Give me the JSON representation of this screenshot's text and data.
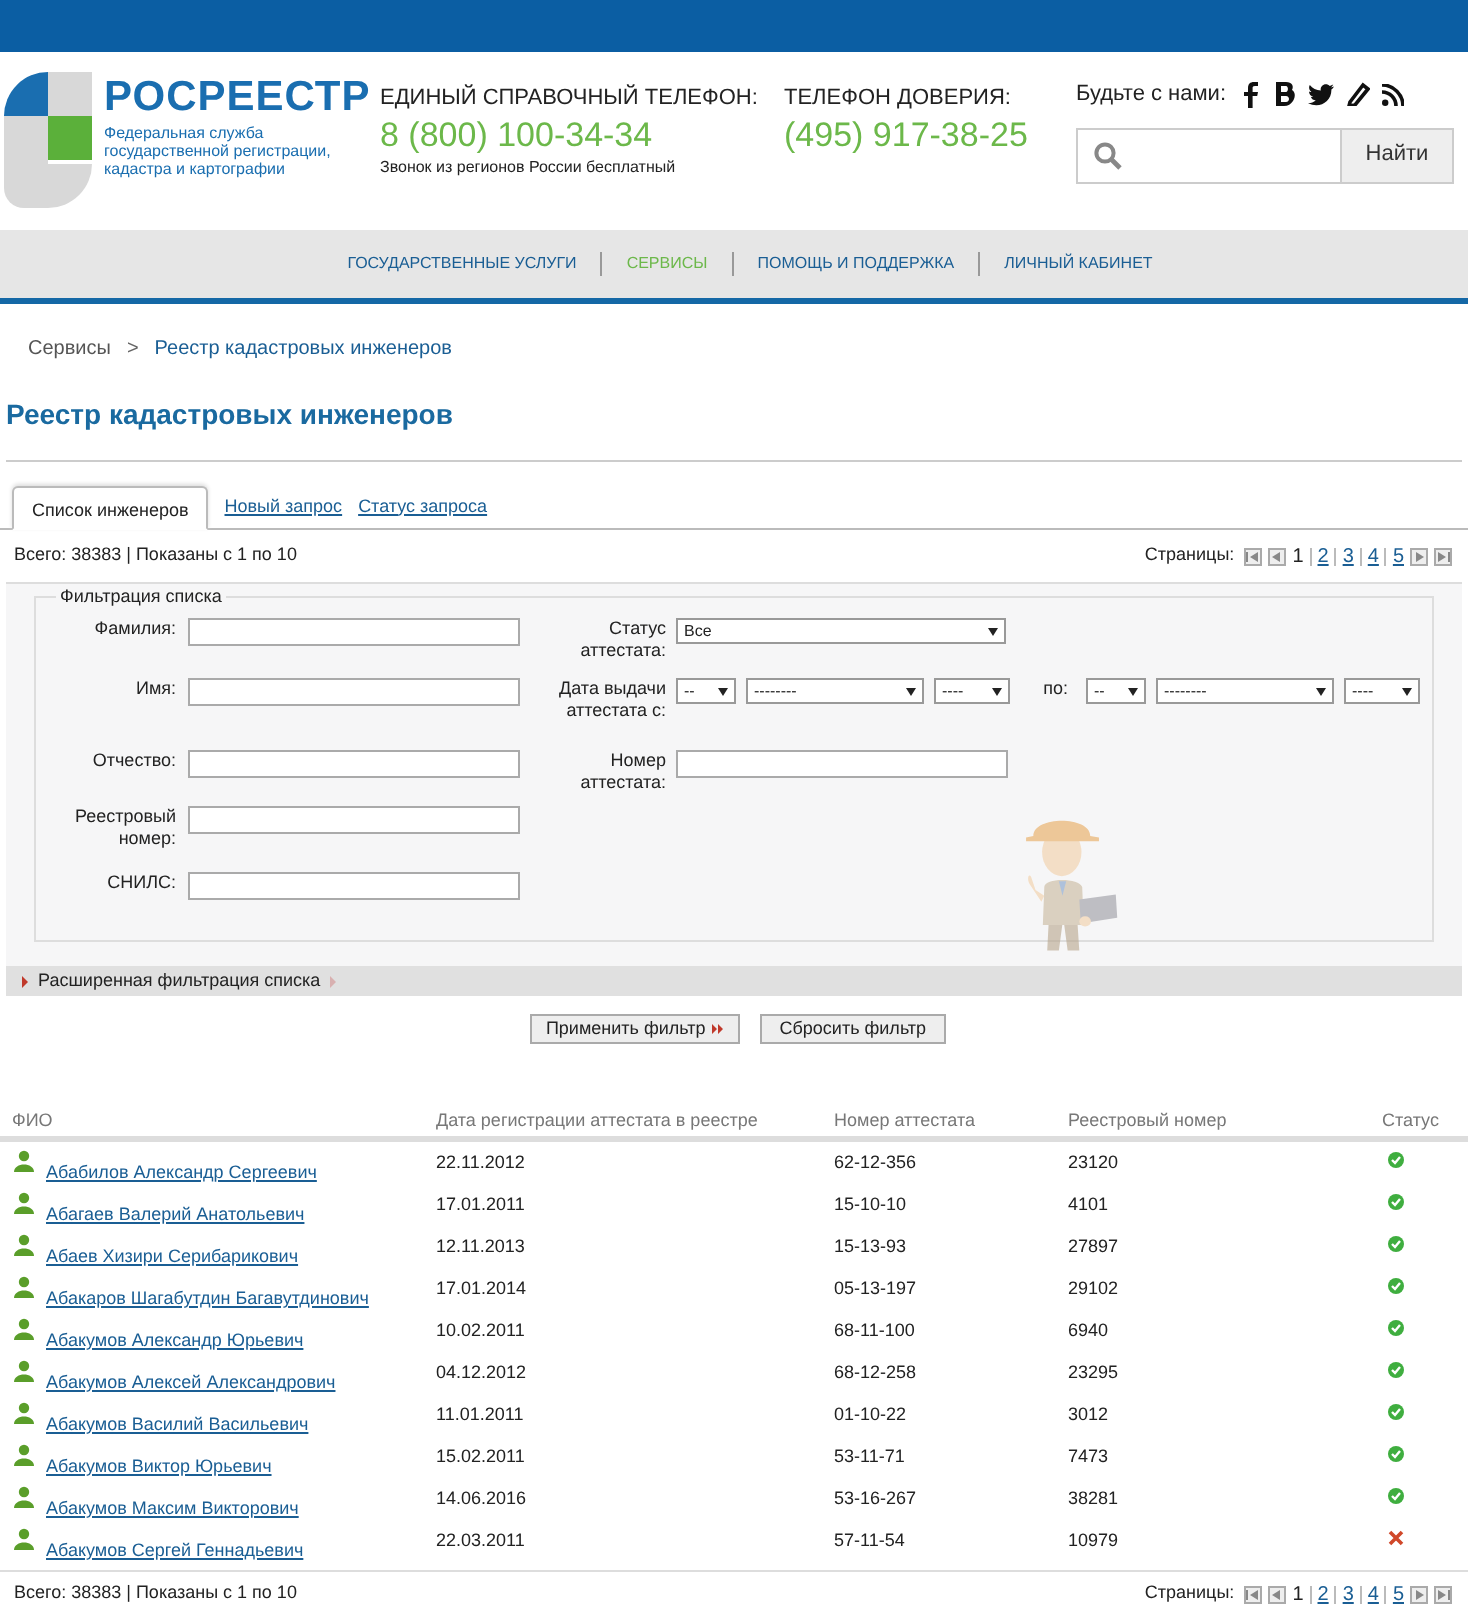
{
  "header": {
    "logo_name": "РОСРЕЕСТР",
    "logo_subtitle": "Федеральная служба государственной регистрации, кадастра и картографии",
    "hotline_label": "ЕДИНЫЙ СПРАВОЧНЫЙ ТЕЛЕФОН:",
    "hotline_phone": "8 (800) 100-34-34",
    "hotline_note": "Звонок из регионов России бесплатный",
    "trust_label": "ТЕЛЕФОН ДОВЕРИЯ:",
    "trust_phone": "(495) 917-38-25",
    "social_label": "Будьте с нами:",
    "search_button": "Найти"
  },
  "nav": [
    {
      "label": "ГОСУДАРСТВЕННЫЕ УСЛУГИ",
      "selected": false
    },
    {
      "label": "СЕРВИСЫ",
      "selected": true
    },
    {
      "label": "ПОМОЩЬ И ПОДДЕРЖКА",
      "selected": false
    },
    {
      "label": "ЛИЧНЫЙ КАБИНЕТ",
      "selected": false
    }
  ],
  "breadcrumb": [
    "Сервисы",
    "Реестр кадастровых инженеров"
  ],
  "breadcrumb_separator": ">",
  "title": "Реестр кадастровых инженеров",
  "tabs": [
    {
      "label": "Список инженеров",
      "selected": true
    },
    {
      "label": "Новый запрос",
      "selected": false
    },
    {
      "label": "Статус запроса",
      "selected": false
    }
  ],
  "summary": "Всего: 38383 | Показаны с 1 по 10",
  "pager": {
    "label": "Страницы:",
    "pages": [
      {
        "label": "1",
        "selected": true
      },
      {
        "label": "2",
        "selected": false
      },
      {
        "label": "3",
        "selected": false
      },
      {
        "label": "4",
        "selected": false
      },
      {
        "label": "5",
        "selected": false
      }
    ]
  },
  "filter": {
    "legend": "Фильтрация списка",
    "left_fields": [
      {
        "label": "Фамилия:"
      },
      {
        "label": "Имя:"
      },
      {
        "label": "Отчество:"
      },
      {
        "label": "Реестровый номер:"
      },
      {
        "label": "СНИЛС:"
      }
    ],
    "status_label": "Статус аттестата:",
    "status_value": "Все",
    "date_label": "Дата выдачи аттестата с:",
    "date_from": [
      "--",
      "--------",
      "----"
    ],
    "date_to_label": "по:",
    "date_to": [
      "--",
      "--------",
      "----"
    ],
    "number_label": "Номер аттестата:",
    "extended": "Расширенная фильтрация списка",
    "apply": "Применить фильтр",
    "reset": "Сбросить фильтр"
  },
  "table": {
    "columns": [
      "ФИО",
      "Дата регистрации аттестата в реестре",
      "Номер аттестата",
      "Реестровый номер",
      "Статус"
    ],
    "rows": [
      {
        "name": "Абабилов Александр Сергеевич",
        "date": "22.11.2012",
        "cert": "62-12-356",
        "reg": "23120",
        "valid": true
      },
      {
        "name": "Абагаев Валерий Анатольевич",
        "date": "17.01.2011",
        "cert": "15-10-10",
        "reg": "4101",
        "valid": true
      },
      {
        "name": "Абаев Хизири Серибарикович",
        "date": "12.11.2013",
        "cert": "15-13-93",
        "reg": "27897",
        "valid": true
      },
      {
        "name": "Абакаров Шагабутдин Багавутдинович",
        "date": "17.01.2014",
        "cert": "05-13-197",
        "reg": "29102",
        "valid": true
      },
      {
        "name": "Абакумов Александр Юрьевич",
        "date": "10.02.2011",
        "cert": "68-11-100",
        "reg": "6940",
        "valid": true
      },
      {
        "name": "Абакумов Алексей Александрович",
        "date": "04.12.2012",
        "cert": "68-12-258",
        "reg": "23295",
        "valid": true
      },
      {
        "name": "Абакумов Василий Васильевич",
        "date": "11.01.2011",
        "cert": "01-10-22",
        "reg": "3012",
        "valid": true
      },
      {
        "name": "Абакумов Виктор Юрьевич",
        "date": "15.02.2011",
        "cert": "53-11-71",
        "reg": "7473",
        "valid": true
      },
      {
        "name": "Абакумов Максим Викторович",
        "date": "14.06.2016",
        "cert": "53-16-267",
        "reg": "38281",
        "valid": true
      },
      {
        "name": "Абакумов Сергей Геннадьевич",
        "date": "22.03.2011",
        "cert": "57-11-54",
        "reg": "10979",
        "valid": false
      }
    ]
  },
  "footer_summary": "Всего: 38383 | Показаны с 1 по 10",
  "footer_pager": {
    "label": "Страницы:",
    "pages": [
      {
        "label": "1",
        "selected": true
      },
      {
        "label": "2",
        "selected": false
      },
      {
        "label": "3",
        "selected": false
      },
      {
        "label": "4",
        "selected": false
      },
      {
        "label": "5",
        "selected": false
      }
    ]
  }
}
